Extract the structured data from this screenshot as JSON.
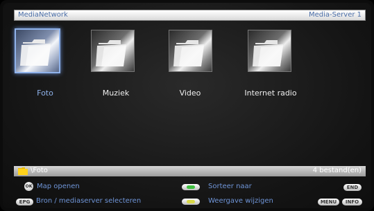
{
  "header": {
    "left_title": "MediaNetwork",
    "right_title": "Media-Server 1"
  },
  "folders": [
    {
      "label": "Foto",
      "selected": true
    },
    {
      "label": "Muziek",
      "selected": false
    },
    {
      "label": "Video",
      "selected": false
    },
    {
      "label": "Internet radio",
      "selected": false
    }
  ],
  "status_bar": {
    "path": "\\Foto",
    "count": "4 bestand(en)"
  },
  "hints": {
    "ok_key": "OK",
    "open_folder": "Map openen",
    "epg_key": "EPG",
    "select_source": "Bron / mediaserver selecteren",
    "sort_by": "Sorteer naar",
    "change_view": "Weergave wijzigen",
    "end_key": "END",
    "menu_key": "MENU",
    "info_key": "INFO"
  },
  "colors": {
    "accent": "#6f95d8",
    "green_button": "#3fbf3f",
    "yellow_button": "#d8d848"
  }
}
